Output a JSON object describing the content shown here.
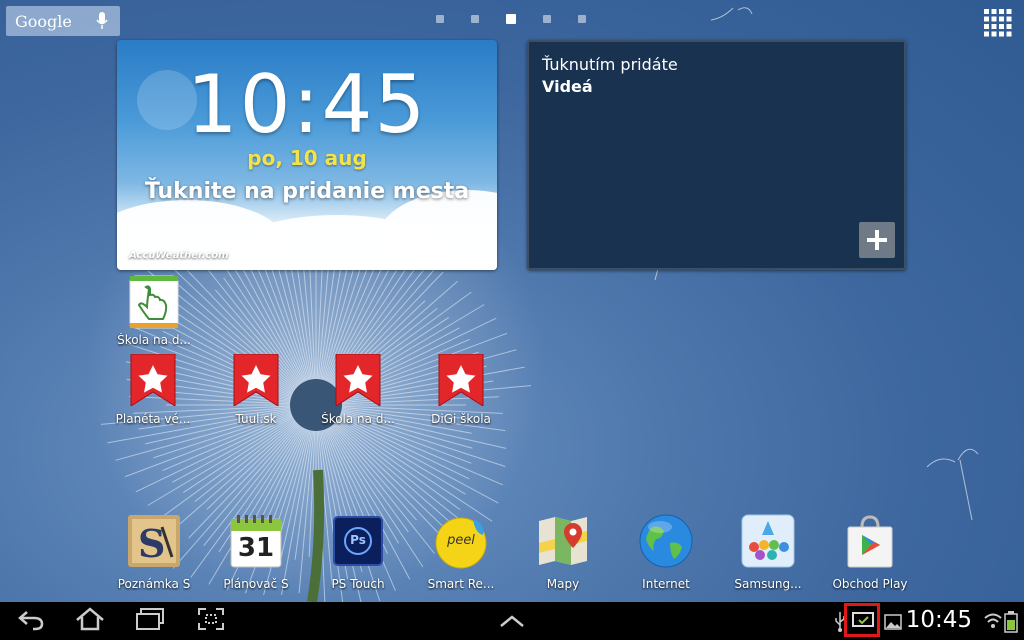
{
  "search": {
    "label": "Google"
  },
  "pager": {
    "count": 5,
    "active_index": 2
  },
  "weather_widget": {
    "time": "10:45",
    "date": "po, 10 aug",
    "city_prompt": "Ťuknite na pridanie mesta",
    "brand": "AccuWeather.com"
  },
  "video_widget": {
    "line1": "Ťuknutím pridáte",
    "line2": "Videá"
  },
  "home_shortcuts": [
    {
      "label": "Škola na d...",
      "icon": "skola-hand-icon"
    },
    {
      "label": "Planéta vé...",
      "icon": "bookmark-star-icon"
    },
    {
      "label": "Tuul.sk",
      "icon": "bookmark-star-icon"
    },
    {
      "label": "Škola na d...",
      "icon": "bookmark-star-icon"
    },
    {
      "label": "DiGi škola",
      "icon": "bookmark-star-icon"
    }
  ],
  "dock": [
    {
      "label": "Poznámka S",
      "icon": "s-note-icon"
    },
    {
      "label": "Plánovač S",
      "icon": "calendar-icon",
      "day": "31"
    },
    {
      "label": "PS Touch",
      "icon": "ps-touch-icon",
      "badge": "Ps"
    },
    {
      "label": "Smart Re...",
      "icon": "peel-remote-icon",
      "badge": "peel"
    },
    {
      "label": "Mapy",
      "icon": "maps-icon"
    },
    {
      "label": "Internet",
      "icon": "globe-icon"
    },
    {
      "label": "Samsung...",
      "icon": "samsung-apps-icon"
    },
    {
      "label": "Obchod Play",
      "icon": "play-store-icon"
    }
  ],
  "status_bar": {
    "time": "10:45",
    "icons": [
      "usb-icon",
      "screen-mirroring-icon",
      "gallery-icon",
      "wifi-icon",
      "battery-icon"
    ]
  },
  "colors": {
    "star_red": "#e2262a",
    "highlight": "#e01818",
    "date_yellow": "#f3e34a"
  }
}
